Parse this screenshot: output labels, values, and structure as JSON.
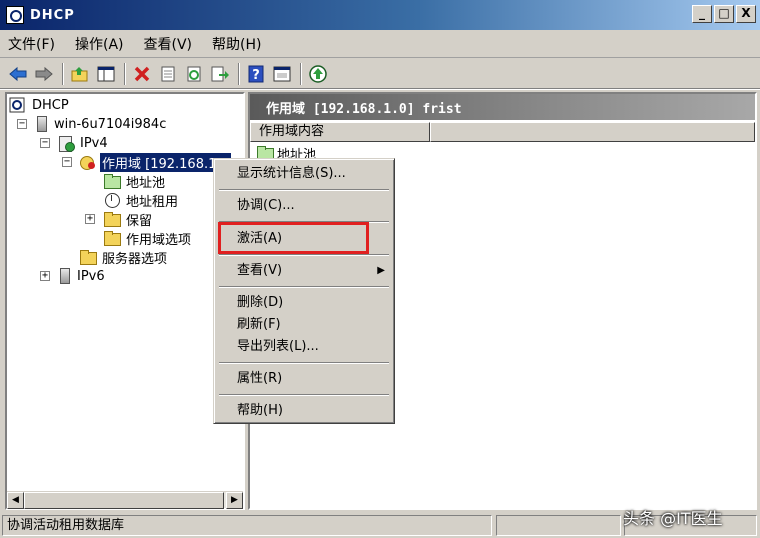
{
  "window": {
    "title": "DHCP",
    "buttons": {
      "minimize": "_",
      "maximize": "□",
      "close": "X"
    }
  },
  "menubar": [
    {
      "label": "文件(F)"
    },
    {
      "label": "操作(A)"
    },
    {
      "label": "查看(V)"
    },
    {
      "label": "帮助(H)"
    }
  ],
  "toolbar": {
    "icons": [
      "back-icon",
      "forward-icon",
      "up-folder-icon",
      "show-hide-tree-icon",
      "delete-icon",
      "properties-icon",
      "refresh-icon",
      "export-icon",
      "help-icon",
      "view-icon",
      "activate-icon"
    ]
  },
  "tree": {
    "root": "DHCP",
    "server": "win-6u7104i984c",
    "ipv4": "IPv4",
    "scope": "作用域 [192.168.1.0",
    "address_pool": "地址池",
    "address_leases": "地址租用",
    "reservations": "保留",
    "scope_options": "作用域选项",
    "server_options": "服务器选项",
    "ipv6": "IPv6",
    "expanders": {
      "collapse": "−",
      "expand": "+"
    }
  },
  "right_pane": {
    "header": "作用域 [192.168.1.0] frist",
    "column": "作用域内容",
    "rows": [
      "地址池"
    ]
  },
  "context_menu": {
    "items": [
      {
        "label": "显示统计信息(S)..."
      },
      {
        "label": "协调(C)..."
      },
      {
        "label": "激活(A)"
      },
      {
        "label": "查看(V)",
        "submenu_arrow": "▶"
      },
      {
        "label": "删除(D)"
      },
      {
        "label": "刷新(F)"
      },
      {
        "label": "导出列表(L)..."
      },
      {
        "label": "属性(R)"
      },
      {
        "label": "帮助(H)"
      }
    ]
  },
  "status_bar": {
    "text": "协调活动租用数据库"
  },
  "watermark": "头条 @IT医生",
  "colors": {
    "title_start": "#0a246a",
    "highlight_box": "#e02020",
    "selection": "#0a246a"
  }
}
